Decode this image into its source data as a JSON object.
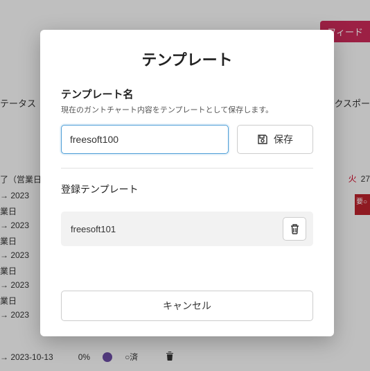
{
  "background": {
    "feedback": "フィード",
    "status": "テータス",
    "export": "クスポー",
    "done_label": "了（営業日",
    "rows": [
      "→ 2023",
      "業日",
      "→ 2023",
      "業日",
      "→ 2023",
      "業日",
      "→ 2023",
      "業日",
      "→ 2023"
    ],
    "bottom": {
      "date": "→ 2023-10-13",
      "percent": "0%",
      "status": "○済"
    },
    "day": {
      "dow": "火",
      "num": "27"
    },
    "red": "要○"
  },
  "modal": {
    "title": "テンプレート",
    "name_label": "テンプレート名",
    "name_hint": "現在のガントチャート内容をテンプレートとして保存します。",
    "name_value": "freesoft100",
    "save_label": "保存",
    "list_label": "登録テンプレート",
    "items": [
      {
        "name": "freesoft101"
      }
    ],
    "cancel_label": "キャンセル"
  }
}
